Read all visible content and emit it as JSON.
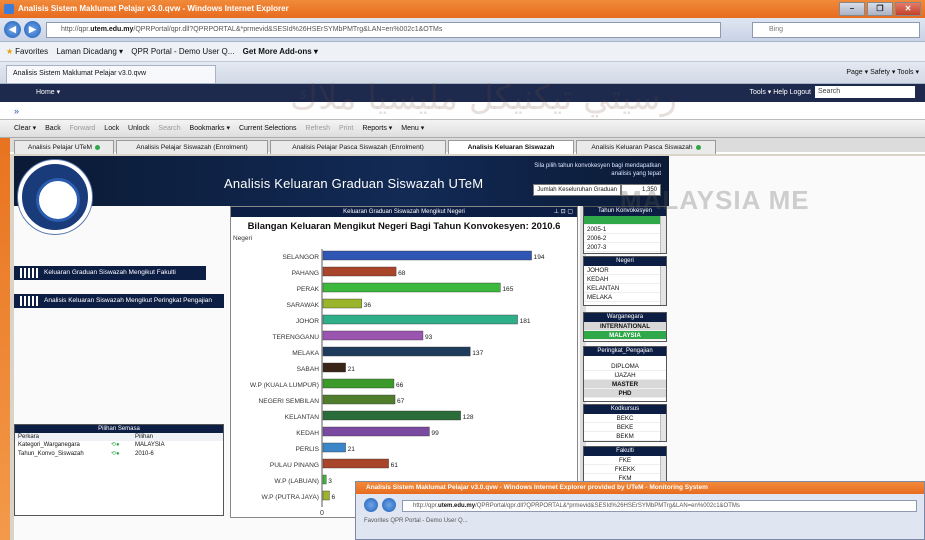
{
  "browser": {
    "window_title": "Analisis Sistem Maklumat Pelajar v3.0.qvw - Windows Internet Explorer",
    "url_prefix": "http://qpr.",
    "url_host": "utem.edu.my",
    "url_path": "/QPRPortal/qpr.dll?QPRPORTAL&*prmevid&SESId%26HSErSYMbPMTrg&LAN=en%002c1&OTMs",
    "search_placeholder": "Bing",
    "favorites_label": "Favorites",
    "fav_links": [
      "Laman Dicadang ▾",
      "QPR Portal - Demo User Q...",
      "Get More Add-ons ▾"
    ],
    "tab_title": "Analisis Sistem Maklumat Pelajar v3.0.qvw",
    "tab_tools": "Page ▾   Safety ▾   Tools ▾",
    "window_buttons": [
      "–",
      "❐",
      "✕"
    ]
  },
  "qlik_nav": {
    "home": "Home ▾",
    "right_items": "Tools ▾    Help    Logout",
    "search_value": "Search"
  },
  "toolbar_items": [
    "Clear ▾",
    "Back",
    "Forward",
    "Lock",
    "Unlock",
    "Search",
    "Bookmarks ▾",
    "Current Selections",
    "Refresh",
    "Print",
    "Reports ▾",
    "Menu ▾"
  ],
  "sheet_tabs": [
    "Analisis Pelajar UTeM",
    "Analisis Pelajar Siswazah (Enrolment)",
    "Analisis Pelajar Pasca Siswazah (Enrolment)",
    "Analisis Keluaran Siswazah",
    "Analisis Keluaran Pasca Siswazah"
  ],
  "banner": {
    "title": "Analisis Keluaran Graduan Siswazah UTeM",
    "hint": "Sila pilih tahun konvokesyen bagi mendapatkan analisis yang tepat",
    "count_label": "Jumlah Keseluruhan Graduan",
    "count_value": "1,350"
  },
  "left_nav": [
    "Keluaran Graduan Siswazah Mengikut Fakulti",
    "Analisis Keluaran Siswazah Mengikut Peringkat Pengajian"
  ],
  "chart_caption": "Keluaran Graduan Siswazah Mengikut Negeri",
  "chart_controls": "⊥ ⊡ ▢",
  "chart_data": {
    "type": "bar",
    "orientation": "horizontal",
    "title": "Bilangan Keluaran Mengikut Negeri Bagi Tahun Konvokesyen: 2010.6",
    "ylabel": "Negeri",
    "categories": [
      "SELANGOR",
      "PAHANG",
      "PERAK",
      "SARAWAK",
      "JOHOR",
      "TERENGGANU",
      "MELAKA",
      "SABAH",
      "W.P (KUALA LUMPUR)",
      "NEGERI SEMBILAN",
      "KELANTAN",
      "KEDAH",
      "PERLIS",
      "PULAU PINANG",
      "W.P (LABUAN)",
      "W.P (PUTRA JAYA)"
    ],
    "values": [
      194,
      68,
      165,
      36,
      181,
      93,
      137,
      21,
      66,
      67,
      128,
      99,
      21,
      61,
      3,
      6
    ],
    "colors": [
      "#2f56b5",
      "#a8452a",
      "#3cb83c",
      "#9bb52b",
      "#2fae8a",
      "#9a55b0",
      "#1f3b5c",
      "#3a2418",
      "#3c9a2a",
      "#4f7d2c",
      "#2b6d3a",
      "#7a4aa0",
      "#3a86c8",
      "#a8452a",
      "#3cb83c",
      "#9bb52b"
    ],
    "xlim": [
      0,
      200
    ],
    "axis_zero": "0",
    "grid": false
  },
  "panels": {
    "tahun": {
      "title": "Tahun Konvokesyen",
      "items": [
        "",
        "2005-1",
        "2006-2",
        "2007-3"
      ]
    },
    "negeri": {
      "title": "Negeri",
      "items": [
        "JOHOR",
        "KEDAH",
        "KELANTAN",
        "MELAKA"
      ]
    },
    "warga": {
      "title": "Warganegara",
      "items": [
        "INTERNATIONAL",
        "MALAYSIA"
      ]
    },
    "peringkat": {
      "title": "Peringkat_Pengajian",
      "items": [
        "DIPLOMA",
        "IJAZAH",
        "MASTER",
        "PHD"
      ]
    },
    "kod": {
      "title": "Kodkursus",
      "items": [
        "BEKC",
        "BEKE",
        "BEKM"
      ]
    },
    "fakulti": {
      "title": "Fakulti",
      "items": [
        "FKE",
        "FKEKK",
        "FKM"
      ]
    }
  },
  "selections": {
    "title": "Pilihan Semasa",
    "col_field": "Perkara",
    "col_value": "Pilihan",
    "rows": [
      {
        "field": "Kategori_Warganegara",
        "value": "MALAYSIA"
      },
      {
        "field": "Tahun_Konvo_Siswazah",
        "value": "2010-6"
      }
    ]
  },
  "popup": {
    "title": "Analisis Sistem Maklumat Pelajar v3.0.qvw - Windows Internet Explorer provided by UTeM - Monitoring System",
    "url_prefix": "http://qpr.",
    "url_host": "utem.edu.my",
    "url_path": "/QPRPortal/qpr.dll?QPRPORTAL&*prmevid&SESId%26HSErSYMbPMTrg&LAN=en%002c1&OTMs",
    "sub": "Favorites   QPR Portal - Demo User Q..."
  },
  "watermark": "MALAYSIA ME",
  "watermark_arabic": "رسيتي تيكنيكل مليسيا ملاك"
}
